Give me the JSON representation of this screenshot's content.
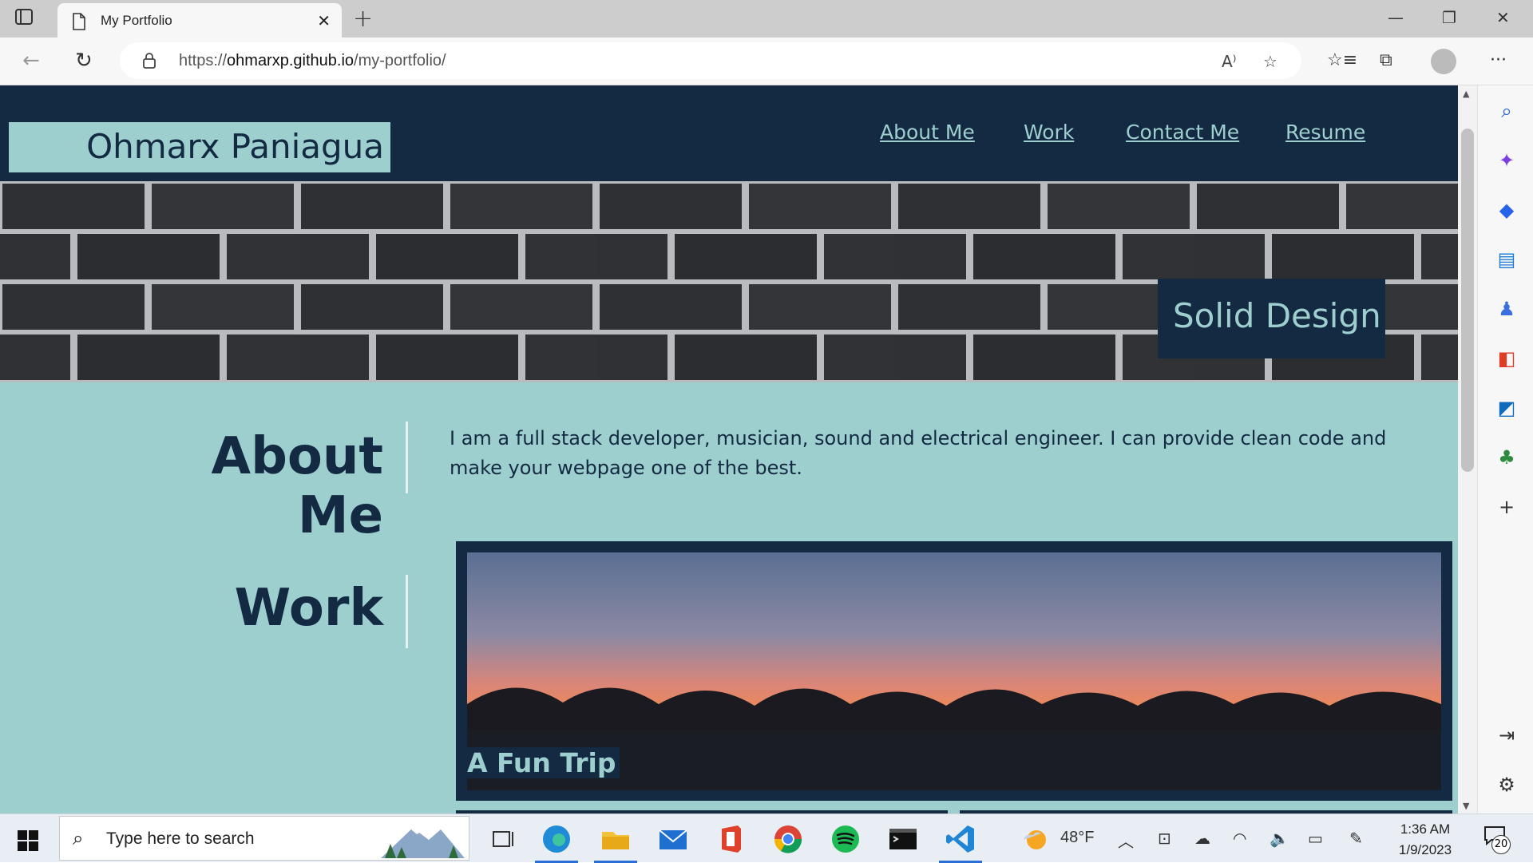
{
  "browser": {
    "tab_title": "My Portfolio",
    "url_prefix": "https://",
    "url_host": "ohmarxp.github.io",
    "url_path": "/my-portfolio/"
  },
  "page": {
    "brand": "Ohmarx Paniagua",
    "nav": [
      "About Me",
      "Work",
      "Contact Me",
      "Resume"
    ],
    "hero_badge": "Solid Design",
    "about_title": "About Me",
    "about_text": "I am a full stack developer, musician, sound and electrical engineer. I can provide clean code and make your webpage one of the best.",
    "work_title": "Work",
    "work_item_label": "A Fun Trip"
  },
  "taskbar": {
    "search_placeholder": "Type here to search",
    "weather": "48°F",
    "time": "1:36 AM",
    "date": "1/9/2023",
    "notification_count": "20"
  },
  "colors": {
    "navy": "#132a42",
    "teal": "#9ecfcf"
  }
}
